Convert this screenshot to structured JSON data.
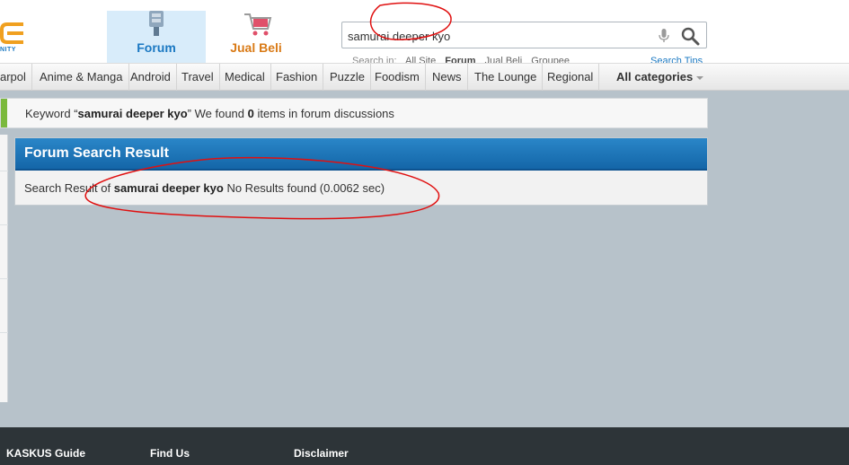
{
  "header": {
    "logo_text": "NITY",
    "tabs": [
      {
        "label": "Forum"
      },
      {
        "label": "Jual Beli"
      }
    ],
    "search": {
      "value": "samurai deeper kyo",
      "search_in_label": "Search in:",
      "options": [
        "All Site",
        "Forum",
        "Jual Beli",
        "Groupee"
      ],
      "tips_label": "Search Tips"
    }
  },
  "categories": [
    "arpol",
    "Anime & Manga",
    "Android",
    "Travel",
    "Medical",
    "Fashion",
    "Puzzle",
    "Foodism",
    "News",
    "The Lounge",
    "Regional"
  ],
  "all_categories_label": "All categories",
  "keyword_bar": {
    "prefix": "Keyword “",
    "keyword": "samurai deeper kyo",
    "middle": "” We found ",
    "count": "0",
    "suffix": " items in forum discussions"
  },
  "result": {
    "title": "Forum Search Result",
    "prefix": "Search Result of ",
    "keyword": "samurai deeper kyo",
    "suffix": " No Results found (0.0062 sec)"
  },
  "footer": {
    "links": [
      "KASKUS Guide",
      "Find Us",
      "Disclaimer"
    ]
  },
  "colors": {
    "brand_blue": "#1a78c2",
    "jualbeli_orange": "#d97a16",
    "accent_green": "#7bb93d",
    "annotation_red": "#e01010"
  }
}
